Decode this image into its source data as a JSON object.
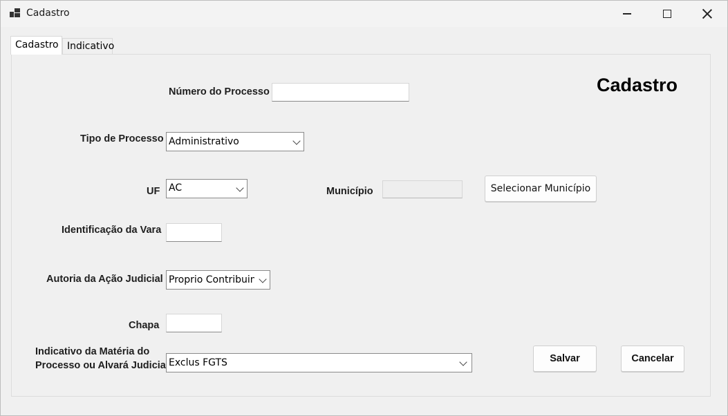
{
  "window": {
    "title": "Cadastro",
    "icon": "app-window-icon"
  },
  "tabs": [
    {
      "label": "Cadastro"
    },
    {
      "label": "Indicativo"
    }
  ],
  "form": {
    "heading": "Cadastro",
    "numero_processo": {
      "label": "Número do Processo",
      "value": ""
    },
    "tipo_processo": {
      "label": "Tipo de Processo",
      "value": "Administrativo"
    },
    "uf": {
      "label": "UF",
      "value": "AC"
    },
    "municipio": {
      "label": "Município",
      "value": ""
    },
    "selecionar_municipio": "Selecionar Município",
    "identificacao_vara": {
      "label": "Identificação da Vara",
      "value": ""
    },
    "autoria": {
      "label": "Autoria da Ação Judicial",
      "value": "Proprio Contribuinte"
    },
    "chapa": {
      "label": "Chapa",
      "value": ""
    },
    "indicativo": {
      "label_line1": "Indicativo da Matéria do",
      "label_line2": "Processo ou Alvará Judicial",
      "value": "Exclus FGTS"
    },
    "salvar": "Salvar",
    "cancelar": "Cancelar"
  }
}
